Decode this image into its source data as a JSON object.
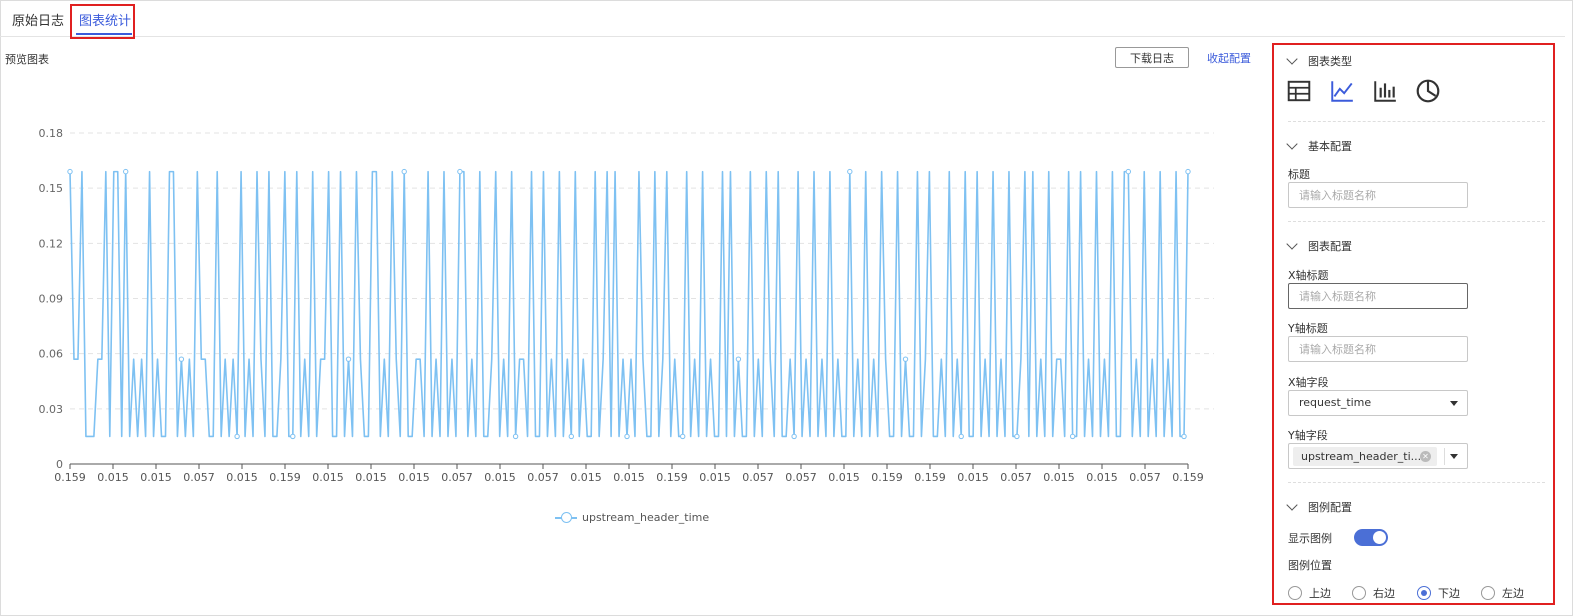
{
  "tabs": {
    "raw_log": "原始日志",
    "chart_stats": "图表统计"
  },
  "preview": {
    "label": "预览图表",
    "download_button": "下载日志",
    "collapse_link": "收起配置"
  },
  "chart_data": {
    "type": "line",
    "title": "",
    "xlabel": "",
    "ylabel": "",
    "ylim": [
      0,
      0.18
    ],
    "yticks": [
      "0.18",
      "0.15",
      "0.12",
      "0.09",
      "0.06",
      "0.03",
      "0"
    ],
    "x_tick_labels": [
      "0.159",
      "0.015",
      "0.015",
      "0.057",
      "0.015",
      "0.159",
      "0.015",
      "0.015",
      "0.015",
      "0.057",
      "0.015",
      "0.057",
      "0.015",
      "0.015",
      "0.159",
      "0.015",
      "0.057",
      "0.057",
      "0.015",
      "0.159",
      "0.159",
      "0.015",
      "0.057",
      "0.015",
      "0.015",
      "0.057",
      "0.159"
    ],
    "grid": true,
    "legend_position": "bottom",
    "series": [
      {
        "name": "upstream_header_time",
        "color": "#7ec1f2",
        "values": [
          0.159,
          0.057,
          0.057,
          0.159,
          0.015,
          0.015,
          0.015,
          0.057,
          0.057,
          0.159,
          0.015,
          0.159,
          0.159,
          0.015,
          0.159,
          0.015,
          0.057,
          0.015,
          0.057,
          0.015,
          0.159,
          0.015,
          0.057,
          0.015,
          0.015,
          0.159,
          0.159,
          0.015,
          0.057,
          0.015,
          0.057,
          0.015,
          0.159,
          0.057,
          0.057,
          0.015,
          0.015,
          0.159,
          0.015,
          0.057,
          0.015,
          0.057,
          0.015,
          0.159,
          0.015,
          0.057,
          0.015,
          0.159,
          0.057,
          0.015,
          0.159,
          0.015,
          0.015,
          0.057,
          0.159,
          0.015,
          0.015,
          0.159,
          0.015,
          0.057,
          0.015,
          0.159,
          0.015,
          0.057,
          0.057,
          0.159,
          0.015,
          0.015,
          0.159,
          0.015,
          0.057,
          0.015,
          0.159,
          0.057,
          0.015,
          0.015,
          0.159,
          0.159,
          0.015,
          0.057,
          0.015,
          0.159,
          0.057,
          0.015,
          0.159,
          0.015,
          0.015,
          0.057,
          0.057,
          0.015,
          0.159,
          0.015,
          0.057,
          0.015,
          0.159,
          0.015,
          0.057,
          0.015,
          0.159,
          0.159,
          0.015,
          0.057,
          0.015,
          0.159,
          0.015,
          0.015,
          0.057,
          0.159,
          0.015,
          0.057,
          0.015,
          0.159,
          0.015,
          0.057,
          0.057,
          0.015,
          0.159,
          0.015,
          0.015,
          0.159,
          0.015,
          0.057,
          0.015,
          0.159,
          0.015,
          0.057,
          0.015,
          0.159,
          0.015,
          0.057,
          0.015,
          0.015,
          0.159,
          0.015,
          0.057,
          0.159,
          0.015,
          0.159,
          0.015,
          0.057,
          0.015,
          0.057,
          0.015,
          0.159,
          0.057,
          0.015,
          0.015,
          0.159,
          0.015,
          0.057,
          0.159,
          0.015,
          0.057,
          0.015,
          0.015,
          0.159,
          0.015,
          0.057,
          0.015,
          0.159,
          0.015,
          0.057,
          0.015,
          0.015,
          0.159,
          0.015,
          0.159,
          0.015,
          0.057,
          0.015,
          0.015,
          0.159,
          0.015,
          0.057,
          0.015,
          0.159,
          0.057,
          0.015,
          0.159,
          0.015,
          0.015,
          0.057,
          0.015,
          0.159,
          0.015,
          0.057,
          0.015,
          0.159,
          0.015,
          0.057,
          0.015,
          0.159,
          0.015,
          0.057,
          0.015,
          0.015,
          0.159,
          0.015,
          0.057,
          0.015,
          0.159,
          0.015,
          0.057,
          0.015,
          0.159,
          0.057,
          0.015,
          0.015,
          0.159,
          0.015,
          0.057,
          0.015,
          0.015,
          0.159,
          0.015,
          0.057,
          0.159,
          0.015,
          0.015,
          0.057,
          0.015,
          0.159,
          0.015,
          0.057,
          0.015,
          0.159,
          0.015,
          0.015,
          0.159,
          0.015,
          0.057,
          0.015,
          0.159,
          0.015,
          0.057,
          0.015,
          0.159,
          0.015,
          0.015,
          0.057,
          0.159,
          0.015,
          0.159,
          0.015,
          0.057,
          0.015,
          0.159,
          0.015,
          0.057,
          0.057,
          0.015,
          0.159,
          0.015,
          0.015,
          0.159,
          0.015,
          0.057,
          0.015,
          0.159,
          0.015,
          0.057,
          0.015,
          0.159,
          0.015,
          0.015,
          0.159,
          0.159,
          0.015,
          0.057,
          0.015,
          0.159,
          0.015,
          0.057,
          0.015,
          0.159,
          0.015,
          0.057,
          0.015,
          0.159,
          0.015,
          0.015,
          0.159
        ]
      }
    ]
  },
  "panel": {
    "chart_type": {
      "header": "图表类型",
      "icons": [
        "table-icon",
        "line-chart-icon",
        "bar-chart-icon",
        "pie-chart-icon"
      ],
      "selected": "line-chart-icon",
      "accent": "#3b5bdb"
    },
    "basic": {
      "header": "基本配置",
      "title_label": "标题",
      "title_placeholder": "请输入标题名称"
    },
    "chart_config": {
      "header": "图表配置",
      "x_title_label": "X轴标题",
      "x_title_placeholder": "请输入标题名称",
      "y_title_label": "Y轴标题",
      "y_title_placeholder": "请输入标题名称",
      "x_field_label": "X轴字段",
      "x_field_value": "request_time",
      "y_field_label": "Y轴字段",
      "y_field_tag": "upstream_header_ti..."
    },
    "legend": {
      "header": "图例配置",
      "show_label": "显示图例",
      "show_enabled": true,
      "position_label": "图例位置",
      "options": [
        "上边",
        "右边",
        "下边",
        "左边"
      ],
      "selected": "下边"
    }
  }
}
